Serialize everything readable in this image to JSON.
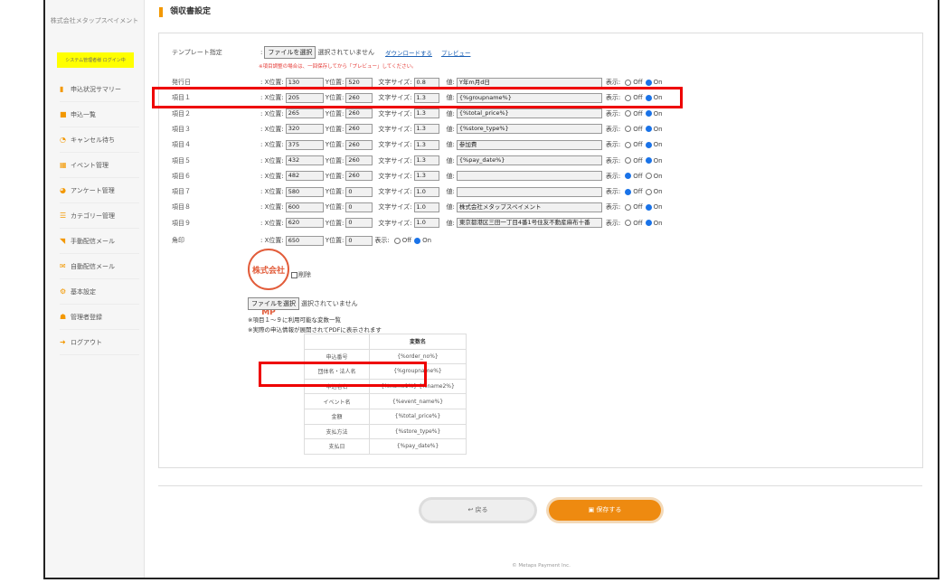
{
  "sidebar": {
    "company": "株式会社メタップスペイメント",
    "system_badge": "システム管理者様 ログイン中",
    "items": [
      {
        "icon": "bar-chart-icon",
        "glyph": "▮",
        "color": "#f39800",
        "label": "申込状況サマリー"
      },
      {
        "icon": "book-icon",
        "glyph": "■",
        "color": "#f39800",
        "label": "申込一覧"
      },
      {
        "icon": "clock-icon",
        "glyph": "◔",
        "color": "#f39800",
        "label": "キャンセル待ち"
      },
      {
        "icon": "grid-icon",
        "glyph": "▦",
        "color": "#f39800",
        "label": "イベント管理"
      },
      {
        "icon": "pie-chart-icon",
        "glyph": "◕",
        "color": "#f39800",
        "label": "アンケート管理"
      },
      {
        "icon": "list-icon",
        "glyph": "☰",
        "color": "#f39800",
        "label": "カテゴリー管理"
      },
      {
        "icon": "rss-icon",
        "glyph": "◥",
        "color": "#f39800",
        "label": "手動配信メール"
      },
      {
        "icon": "envelope-icon",
        "glyph": "✉",
        "color": "#f39800",
        "label": "自動配信メール"
      },
      {
        "icon": "gears-icon",
        "glyph": "⚙",
        "color": "#f39800",
        "label": "基本設定"
      },
      {
        "icon": "users-icon",
        "glyph": "☗",
        "color": "#f39800",
        "label": "管理者登録"
      },
      {
        "icon": "logout-icon",
        "glyph": "➜",
        "color": "#f39800",
        "label": "ログアウト"
      }
    ]
  },
  "page": {
    "title": "領収書設定"
  },
  "template": {
    "label": "テンプレート指定",
    "file_button": "ファイルを選択",
    "file_status": "選択されていません",
    "download_link": "ダウンロードする",
    "preview_link": "プレビュー",
    "warning": "※項目調整の場合は、一回保存してから「プレビュー」してください。"
  },
  "labels": {
    "x": ": X位置:",
    "y": "Y位置:",
    "size": "文字サイズ:",
    "value": "値:",
    "display": "表示:",
    "off": "Off",
    "on": "On"
  },
  "fields": [
    {
      "name": "発行日",
      "x": "130",
      "y": "520",
      "size": "0.8",
      "value": "Y年m月d日",
      "on": true
    },
    {
      "name": "項目１",
      "x": "205",
      "y": "260",
      "size": "1.3",
      "value": "{%groupname%}",
      "on": true
    },
    {
      "name": "項目２",
      "x": "265",
      "y": "260",
      "size": "1.3",
      "value": "{%total_price%}",
      "on": true
    },
    {
      "name": "項目３",
      "x": "320",
      "y": "260",
      "size": "1.3",
      "value": "{%store_type%}",
      "on": true
    },
    {
      "name": "項目４",
      "x": "375",
      "y": "260",
      "size": "1.3",
      "value": "参加費",
      "on": true
    },
    {
      "name": "項目５",
      "x": "432",
      "y": "260",
      "size": "1.3",
      "value": "{%pay_date%}",
      "on": true
    },
    {
      "name": "項目６",
      "x": "482",
      "y": "260",
      "size": "1.3",
      "value": "",
      "on": false
    },
    {
      "name": "項目７",
      "x": "580",
      "y": "0",
      "size": "1.0",
      "value": "",
      "on": false
    },
    {
      "name": "項目８",
      "x": "600",
      "y": "0",
      "size": "1.0",
      "value": "株式会社メタップスペイメント",
      "on": true
    },
    {
      "name": "項目９",
      "x": "620",
      "y": "0",
      "size": "1.0",
      "value": "東京都港区三田一丁目4番1号住友不動産麻布十番",
      "on": true
    }
  ],
  "stamp_row": {
    "name": "角印",
    "x": "650",
    "y": "0",
    "on": true
  },
  "stamp": {
    "image_text": "株式会社MP",
    "delete_label": "削除",
    "file_button": "ファイルを選択",
    "file_status": "選択されていません"
  },
  "notes": [
    "※項目１～９に利用可能な変数一覧",
    "※実際の申込情報が展開されてPDFに表示されます"
  ],
  "variable_table": {
    "header": [
      "",
      "変数名"
    ],
    "rows": [
      [
        "申込番号",
        "{%order_no%}"
      ],
      [
        "団体名・法人名",
        "{%groupname%}"
      ],
      [
        "申込者名",
        "{%name1%} {%name2%}"
      ],
      [
        "イベント名",
        "{%event_name%}"
      ],
      [
        "金額",
        "{%total_price%}"
      ],
      [
        "支払方法",
        "{%store_type%}"
      ],
      [
        "支払日",
        "{%pay_date%}"
      ]
    ]
  },
  "buttons": {
    "back": "戻る",
    "save": "保存する"
  },
  "footer": "© Metaps Payment Inc.",
  "colors": {
    "accent": "#f39800",
    "highlight": "#e00000",
    "badge": "#ffff00"
  }
}
